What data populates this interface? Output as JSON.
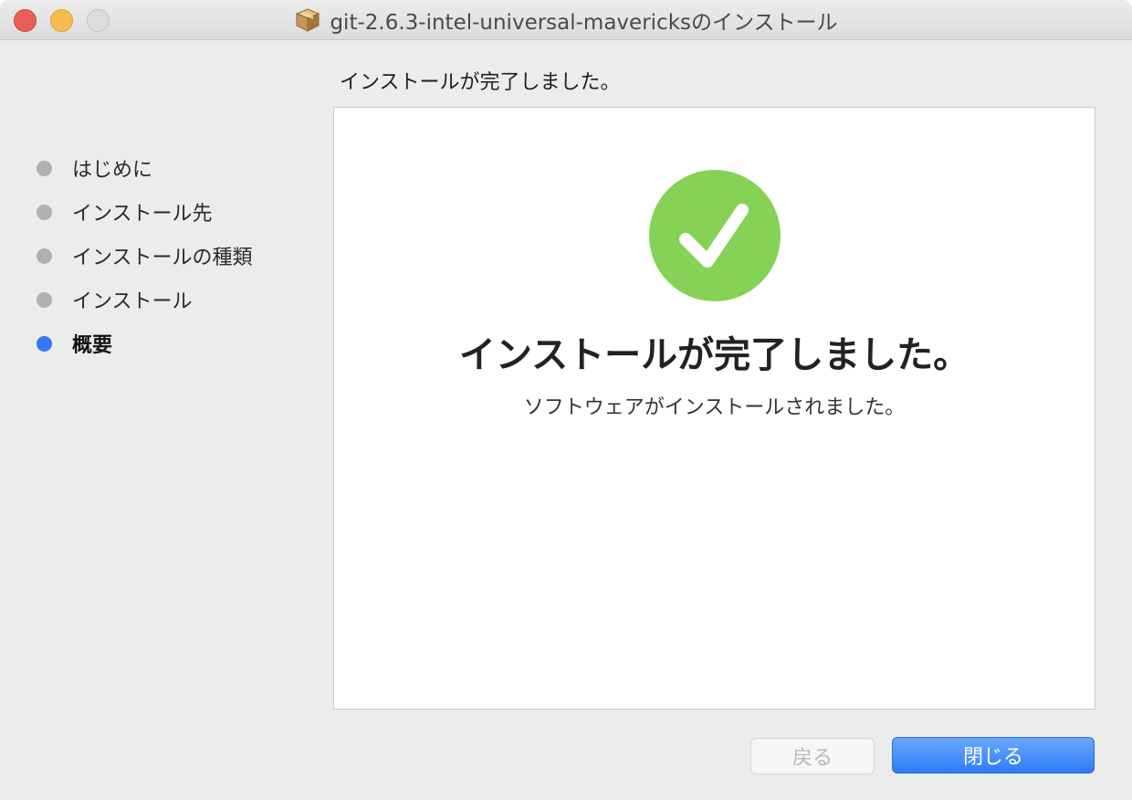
{
  "window": {
    "title": "git-2.6.3-intel-universal-mavericksのインストール"
  },
  "header": {
    "status": "インストールが完了しました。"
  },
  "sidebar": {
    "items": [
      {
        "label": "はじめに",
        "active": false
      },
      {
        "label": "インストール先",
        "active": false
      },
      {
        "label": "インストールの種類",
        "active": false
      },
      {
        "label": "インストール",
        "active": false
      },
      {
        "label": "概要",
        "active": true
      }
    ]
  },
  "main": {
    "icon": "checkmark-circle-icon",
    "title": "インストールが完了しました。",
    "message": "ソフトウェアがインストールされました。"
  },
  "buttons": {
    "back_label": "戻る",
    "close_label": "閉じる"
  },
  "colors": {
    "success_green": "#85d256",
    "accent_blue": "#3478f6"
  }
}
